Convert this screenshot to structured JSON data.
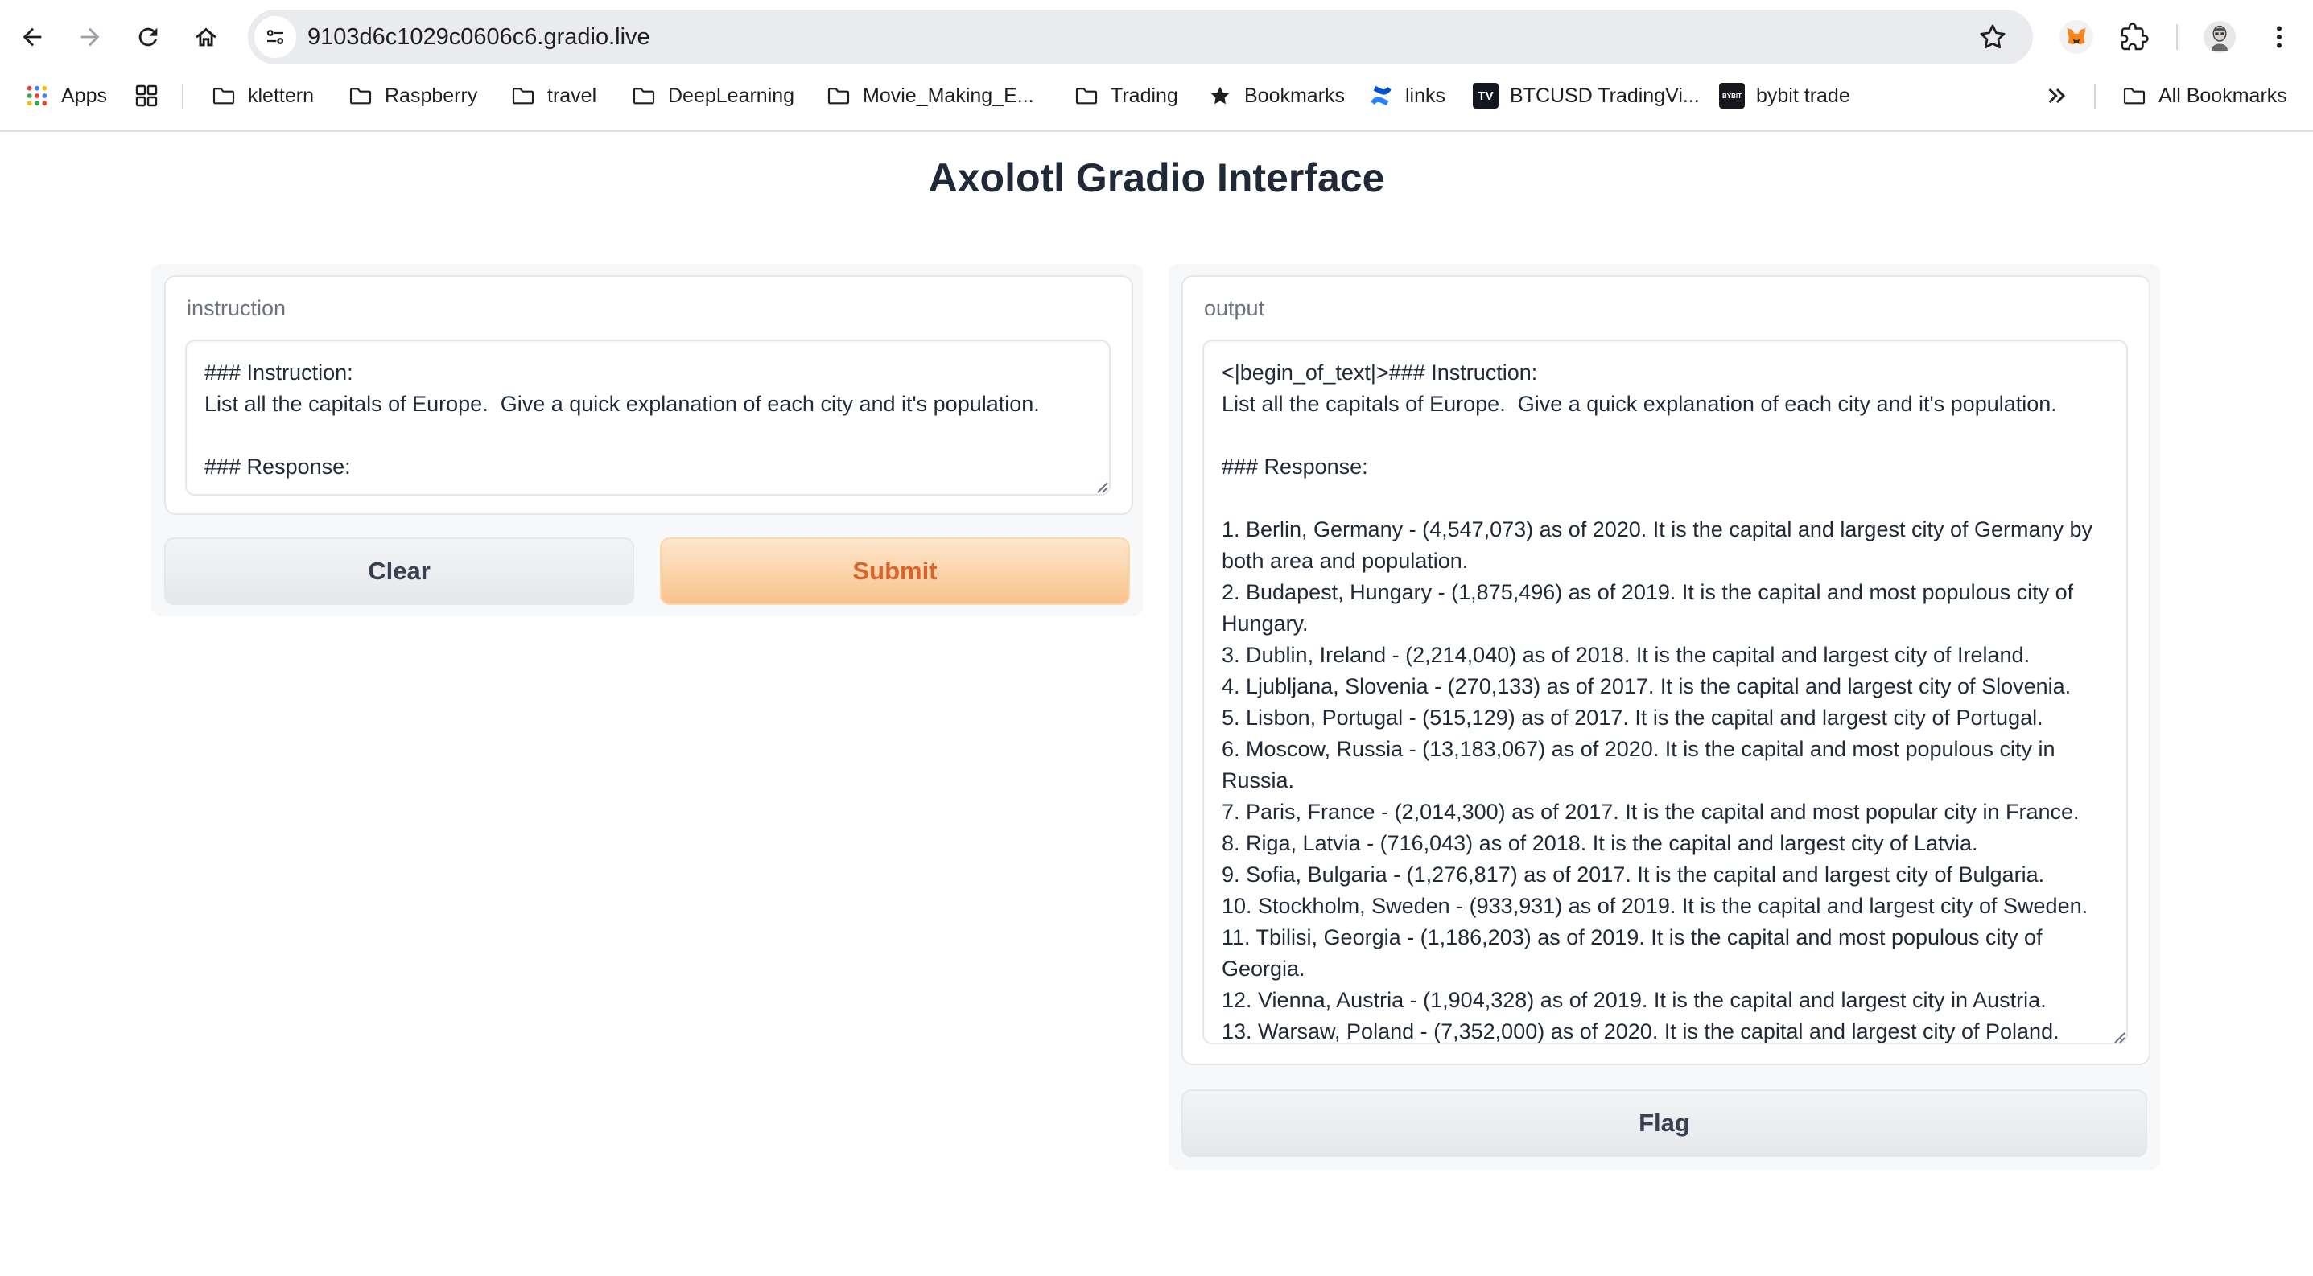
{
  "browser": {
    "url": "9103d6c1029c0606c6.gradio.live",
    "bookmarks": [
      {
        "label": "Apps",
        "icon": "apps-grid-icon"
      },
      {
        "label": "klettern",
        "icon": "folder-icon"
      },
      {
        "label": "Raspberry",
        "icon": "folder-icon"
      },
      {
        "label": "travel",
        "icon": "folder-icon"
      },
      {
        "label": "DeepLearning",
        "icon": "folder-icon"
      },
      {
        "label": "Movie_Making_E...",
        "icon": "folder-icon"
      },
      {
        "label": "Trading",
        "icon": "folder-icon"
      },
      {
        "label": "Bookmarks",
        "icon": "star-icon"
      },
      {
        "label": "links",
        "icon": "confluence-icon"
      },
      {
        "label": "BTCUSD TradingVi...",
        "icon": "tradingview-icon"
      },
      {
        "label": "bybit trade",
        "icon": "bybit-icon"
      },
      {
        "label": "All Bookmarks",
        "icon": "folder-icon"
      }
    ],
    "bybit_logo_text": "BYBIT",
    "tradingview_logo_text": "TV"
  },
  "page": {
    "title": "Axolotl Gradio Interface"
  },
  "instruction": {
    "label": "instruction",
    "value": "### Instruction:\nList all the capitals of Europe.  Give a quick explanation of each city and it's population.\n\n### Response:"
  },
  "buttons": {
    "clear": "Clear",
    "submit": "Submit",
    "flag": "Flag"
  },
  "output": {
    "label": "output",
    "value": "<|begin_of_text|>### Instruction:\nList all the capitals of Europe.  Give a quick explanation of each city and it's population.\n\n### Response:\n\n1. Berlin, Germany - (4,547,073) as of 2020. It is the capital and largest city of Germany by both area and population.\n2. Budapest, Hungary - (1,875,496) as of 2019. It is the capital and most populous city of Hungary.\n3. Dublin, Ireland - (2,214,040) as of 2018. It is the capital and largest city of Ireland.\n4. Ljubljana, Slovenia - (270,133) as of 2017. It is the capital and largest city of Slovenia.\n5. Lisbon, Portugal - (515,129) as of 2017. It is the capital and largest city of Portugal.\n6. Moscow, Russia - (13,183,067) as of 2020. It is the capital and most populous city in Russia.\n7. Paris, France - (2,014,300) as of 2017. It is the capital and most popular city in France.\n8. Riga, Latvia - (716,043) as of 2018. It is the capital and largest city of Latvia.\n9. Sofia, Bulgaria - (1,276,817) as of 2017. It is the capital and largest city of Bulgaria.\n10. Stockholm, Sweden - (933,931) as of 2019. It is the capital and largest city of Sweden.\n11. Tbilisi, Georgia - (1,186,203) as of 2019. It is the capital and most populous city of Georgia.\n12. Vienna, Austria - (1,904,328) as of 2019. It is the capital and largest city in Austria.\n13. Warsaw, Poland - (7,352,000) as of 2020. It is the capital and largest city of Poland.\n<|end_of_text|><|begin_of_text|>package;<|end_of_text|><|begin_of_text|>   }<|end_of_text|>\n<|begin_of_text|>   }"
  },
  "colors": {
    "primary_button_text": "#d9642b",
    "primary_button_bg": "#f8c38c",
    "secondary_button_bg": "#e5e7eb"
  }
}
